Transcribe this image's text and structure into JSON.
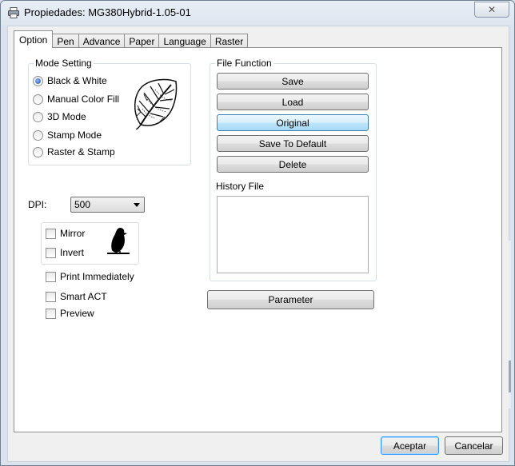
{
  "window": {
    "title": "Propiedades: MG380Hybrid-1.05-01",
    "close_glyph": "✕"
  },
  "tabs": [
    {
      "label": "Option",
      "active": true
    },
    {
      "label": "Pen"
    },
    {
      "label": "Advance"
    },
    {
      "label": "Paper"
    },
    {
      "label": "Language"
    },
    {
      "label": "Raster"
    }
  ],
  "mode_setting": {
    "label": "Mode Setting",
    "options": [
      "Black & White",
      "Manual Color Fill",
      "3D Mode",
      "Stamp Mode",
      "Raster & Stamp"
    ],
    "selected": "Black & White"
  },
  "dpi": {
    "label": "DPI:",
    "value": "500"
  },
  "image_options": {
    "mirror": "Mirror",
    "invert": "Invert"
  },
  "options": {
    "print_immediately": "Print Immediately",
    "smart_act": "Smart ACT",
    "preview": "Preview"
  },
  "file_function": {
    "label": "File Function",
    "buttons": [
      "Save",
      "Load",
      "Original",
      "Save To Default",
      "Delete"
    ],
    "history_label": "History File"
  },
  "parameter_label": "Parameter",
  "footer": {
    "accept": "Aceptar",
    "cancel": "Cancelar"
  },
  "icons": {
    "leaf": "leaf-icon",
    "bird": "bird-icon",
    "printer": "printer-icon"
  }
}
